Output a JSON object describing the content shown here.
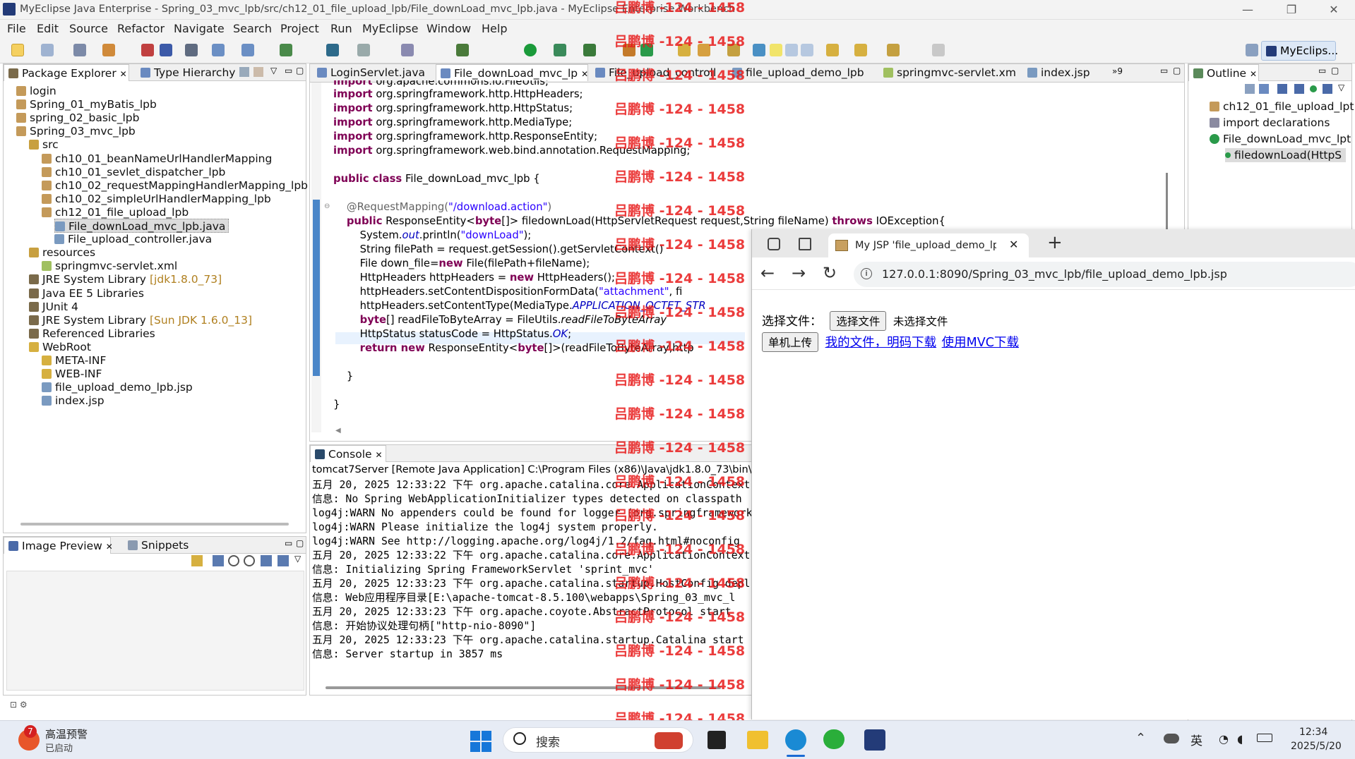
{
  "window": {
    "title": "MyEclipse Java Enterprise - Spring_03_mvc_lpb/src/ch12_01_file_upload_lpb/File_downLoad_mvc_lpb.java - MyEclipse Enterprise Workbench",
    "min": "—",
    "max": "❐",
    "close": "✕"
  },
  "menu": [
    "File",
    "Edit",
    "Source",
    "Refactor",
    "Navigate",
    "Search",
    "Project",
    "Run",
    "MyEclipse",
    "Window",
    "Help"
  ],
  "perspective": "MyEclips...",
  "package_explorer": {
    "tabs": [
      "Package Explorer",
      "Type Hierarchy"
    ],
    "items": [
      {
        "label": "login",
        "extra": ""
      },
      {
        "label": "Spring_01_myBatis_lpb",
        "extra": ""
      },
      {
        "label": "spring_02_basic_lpb",
        "extra": ""
      },
      {
        "label": "Spring_03_mvc_lpb",
        "extra": ""
      },
      {
        "label": "src",
        "extra": ""
      },
      {
        "label": "ch10_01_beanNameUrlHandlerMapping",
        "extra": ""
      },
      {
        "label": "ch10_01_sevlet_dispatcher_lpb",
        "extra": ""
      },
      {
        "label": "ch10_02_requestMappingHandlerMapping_lpb",
        "extra": ""
      },
      {
        "label": "ch10_02_simpleUrlHandlerMapping_lpb",
        "extra": ""
      },
      {
        "label": "ch12_01_file_upload_lpb",
        "extra": ""
      },
      {
        "label": "File_downLoad_mvc_lpb.java",
        "extra": ""
      },
      {
        "label": "File_upload_controller.java",
        "extra": ""
      },
      {
        "label": "resources",
        "extra": ""
      },
      {
        "label": "springmvc-servlet.xml",
        "extra": ""
      },
      {
        "label": "JRE System Library",
        "extra": "[jdk1.8.0_73]"
      },
      {
        "label": "Java EE 5 Libraries",
        "extra": ""
      },
      {
        "label": "JUnit 4",
        "extra": ""
      },
      {
        "label": "JRE System Library",
        "extra": "[Sun JDK 1.6.0_13]"
      },
      {
        "label": "Referenced Libraries",
        "extra": ""
      },
      {
        "label": "WebRoot",
        "extra": ""
      },
      {
        "label": "META-INF",
        "extra": ""
      },
      {
        "label": "WEB-INF",
        "extra": ""
      },
      {
        "label": "file_upload_demo_lpb.jsp",
        "extra": ""
      },
      {
        "label": "index.jsp",
        "extra": ""
      }
    ]
  },
  "image_preview": {
    "tabs": [
      "Image Preview",
      "Snippets"
    ]
  },
  "editor": {
    "tabs": [
      "LoginServlet.java",
      "File_downLoad_mvc_lp",
      "File_upload_controll",
      "file_upload_demo_lpb",
      "springmvc-servlet.xm",
      "index.jsp"
    ],
    "overflow": "»9"
  },
  "outline": {
    "tab": "Outline",
    "items": [
      "ch12_01_file_upload_lpt",
      "import declarations",
      "File_downLoad_mvc_lpt",
      "filedownLoad(HttpS"
    ]
  },
  "console": {
    "tab": "Console",
    "header": "tomcat7Server [Remote Java Application] C:\\Program Files (x86)\\Java\\jdk1.8.0_73\\bin\\",
    "lines": [
      "五月 20, 2025 12:33:22 下午 org.apache.catalina.core.ApplicationContext",
      "信息: No Spring WebApplicationInitializer types detected on classpath",
      "log4j:WARN No appenders could be found for logger (org.springframework",
      "log4j:WARN Please initialize the log4j system properly.",
      "log4j:WARN See http://logging.apache.org/log4j/1.2/faq.html#noconfig",
      "五月 20, 2025 12:33:22 下午 org.apache.catalina.core.ApplicationContext",
      "信息: Initializing Spring FrameworkServlet 'sprint_mvc'",
      "五月 20, 2025 12:33:23 下午 org.apache.catalina.startup.HostConfig depl",
      "信息: Web应用程序目录[E:\\apache-tomcat-8.5.100\\webapps\\Spring_03_mvc_l",
      "五月 20, 2025 12:33:23 下午 org.apache.coyote.AbstractProtocol start",
      "信息: 开始协议处理句柄[\"http-nio-8090\"]",
      "五月 20, 2025 12:33:23 下午 org.apache.catalina.startup.Catalina start",
      "信息: Server startup in 3857 ms"
    ]
  },
  "browser": {
    "tab_title": "My JSP 'file_upload_demo_lpb.jsp",
    "new_tab": "+",
    "url": "127.0.0.1:8090/Spring_03_mvc_lpb/file_upload_demo_lpb.jsp",
    "choose_label": "选择文件：",
    "choose_button": "选择文件",
    "no_file": "未选择文件",
    "upload_button": "单机上传",
    "link1": "我的文件，明码下载",
    "link2": "使用MVC下载"
  },
  "watermark": "吕鹏博 -124 - 1458",
  "taskbar": {
    "weather_title": "高温预警",
    "weather_sub": "已启动",
    "weather_badge": "7",
    "search": "搜索",
    "ime": "英",
    "time": "12:34",
    "date": "2025/5/20"
  }
}
